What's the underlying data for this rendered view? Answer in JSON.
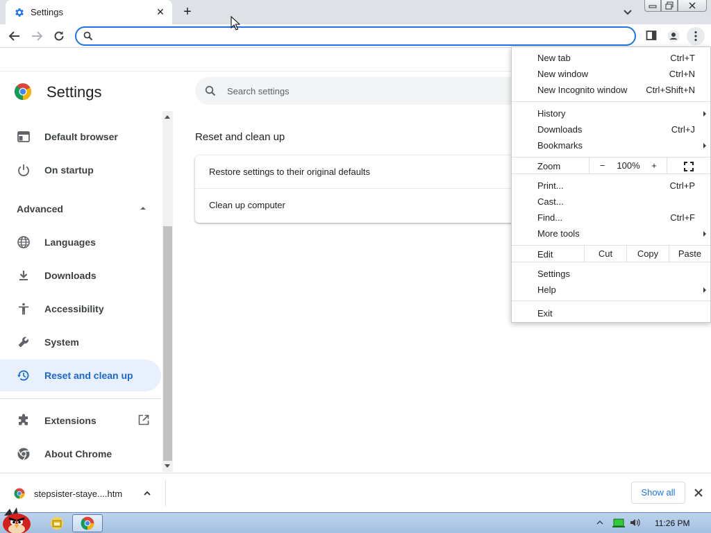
{
  "tab": {
    "title": "Settings",
    "close_glyph": "✕",
    "new_tab_glyph": "+"
  },
  "omnibox": {
    "value": "",
    "placeholder": ""
  },
  "page": {
    "title": "Settings",
    "search_placeholder": "Search settings",
    "section_title": "Reset and clean up",
    "card_items": [
      "Restore settings to their original defaults",
      "Clean up computer"
    ]
  },
  "sidebar": {
    "items": [
      {
        "label": "Default browser",
        "icon": "browser-window-icon"
      },
      {
        "label": "On startup",
        "icon": "power-icon"
      },
      {
        "label": "Languages",
        "icon": "globe-icon"
      },
      {
        "label": "Downloads",
        "icon": "download-icon"
      },
      {
        "label": "Accessibility",
        "icon": "accessibility-icon"
      },
      {
        "label": "System",
        "icon": "wrench-icon"
      },
      {
        "label": "Reset and clean up",
        "icon": "restore-clock-icon",
        "active": true
      },
      {
        "label": "Extensions",
        "icon": "puzzle-icon"
      },
      {
        "label": "About Chrome",
        "icon": "chrome-icon"
      }
    ],
    "advanced_label": "Advanced"
  },
  "menu": {
    "new_tab": {
      "label": "New tab",
      "shortcut": "Ctrl+T"
    },
    "new_window": {
      "label": "New window",
      "shortcut": "Ctrl+N"
    },
    "new_incognito": {
      "label": "New Incognito window",
      "shortcut": "Ctrl+Shift+N"
    },
    "history": {
      "label": "History"
    },
    "downloads": {
      "label": "Downloads",
      "shortcut": "Ctrl+J"
    },
    "bookmarks": {
      "label": "Bookmarks"
    },
    "zoom": {
      "label": "Zoom",
      "minus": "−",
      "value": "100%",
      "plus": "+"
    },
    "print": {
      "label": "Print...",
      "shortcut": "Ctrl+P"
    },
    "cast": {
      "label": "Cast..."
    },
    "find": {
      "label": "Find...",
      "shortcut": "Ctrl+F"
    },
    "more_tools": {
      "label": "More tools"
    },
    "edit": {
      "label": "Edit",
      "cut": "Cut",
      "copy": "Copy",
      "paste": "Paste"
    },
    "settings": {
      "label": "Settings"
    },
    "help": {
      "label": "Help"
    },
    "exit": {
      "label": "Exit"
    }
  },
  "download_shelf": {
    "filename": "stepsister-staye....htm",
    "show_all": "Show all"
  },
  "taskbar": {
    "clock": "11:26 PM"
  },
  "colors": {
    "accent": "#1a73e8",
    "active_nav_bg": "#e8f0fe",
    "active_nav_text": "#1967d2",
    "tabstrip": "#dee1e6"
  }
}
